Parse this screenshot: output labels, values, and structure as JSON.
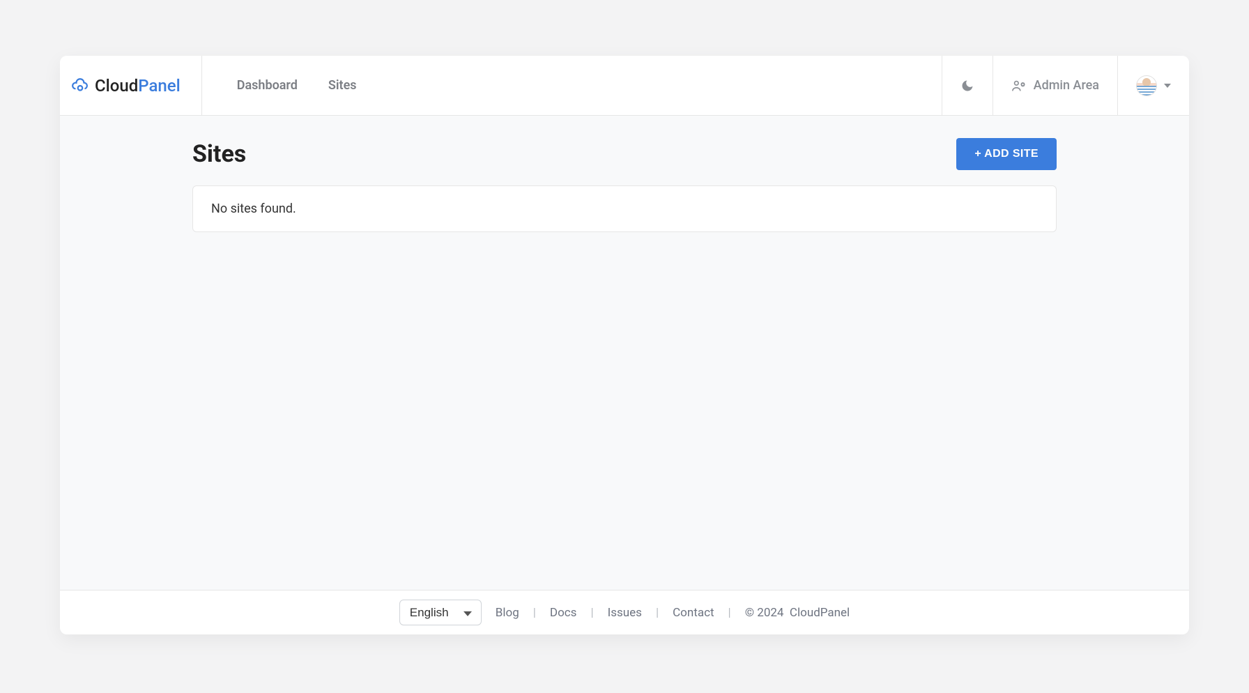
{
  "brand": {
    "name_part1": "Cloud",
    "name_part2": "Panel"
  },
  "nav": {
    "dashboard": "Dashboard",
    "sites": "Sites"
  },
  "header": {
    "admin_area_label": "Admin Area"
  },
  "page": {
    "title": "Sites",
    "add_site_label": "ADD SITE",
    "empty_message": "No sites found."
  },
  "footer": {
    "language_selected": "English",
    "links": {
      "blog": "Blog",
      "docs": "Docs",
      "issues": "Issues",
      "contact": "Contact"
    },
    "copyright_prefix": "© 2024",
    "copyright_brand": "CloudPanel"
  }
}
